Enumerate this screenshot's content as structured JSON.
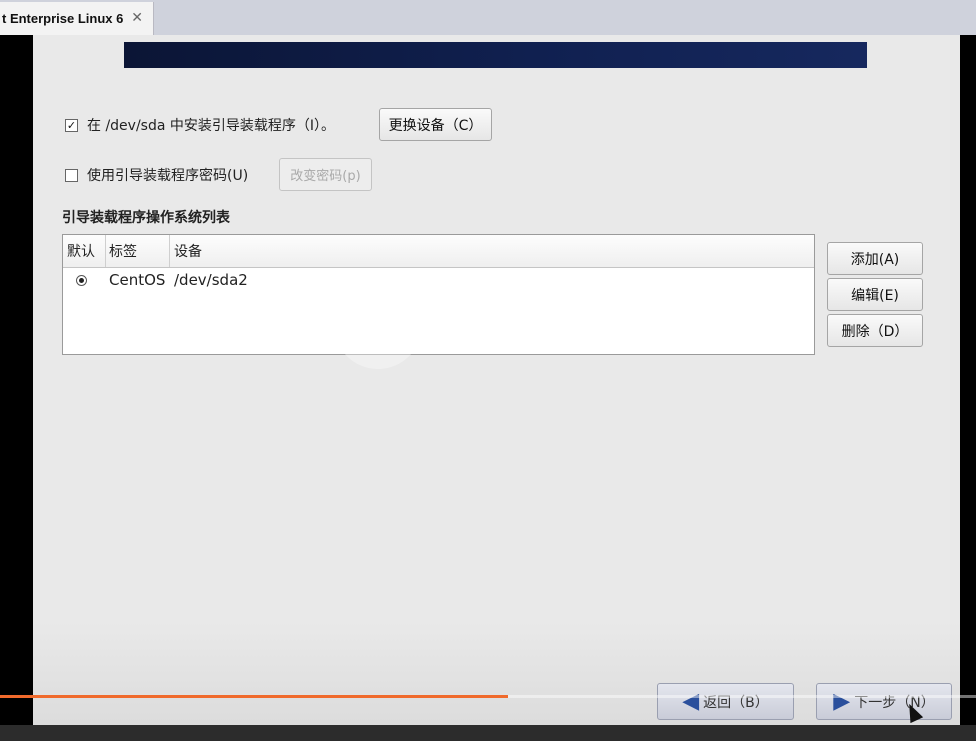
{
  "tab": {
    "title": "t Enterprise Linux 6",
    "close": "✕"
  },
  "bootloader": {
    "install_label": "在 /dev/sda 中安装引导装载程序（I）。",
    "install_checked": true,
    "change_device": "更换设备（C）",
    "use_password_label": "使用引导装载程序密码(U)",
    "use_password_checked": false,
    "change_password": "改变密码(p)",
    "os_list_title": "引导装载程序操作系统列表"
  },
  "table": {
    "headers": [
      "默认",
      "标签",
      "设备"
    ],
    "rows": [
      {
        "default": true,
        "label": "CentOS",
        "device": "/dev/sda2"
      }
    ]
  },
  "side_buttons": {
    "add": "添加(A)",
    "edit": "编辑(E)",
    "delete": "删除（D）"
  },
  "nav": {
    "back": "返回（B）",
    "next": "下一步（N）"
  },
  "video_progress": 0.52,
  "colors": {
    "banner": "#0b1535",
    "progress": "#f06a2c",
    "nav_arrow": "#2a4f9c"
  }
}
